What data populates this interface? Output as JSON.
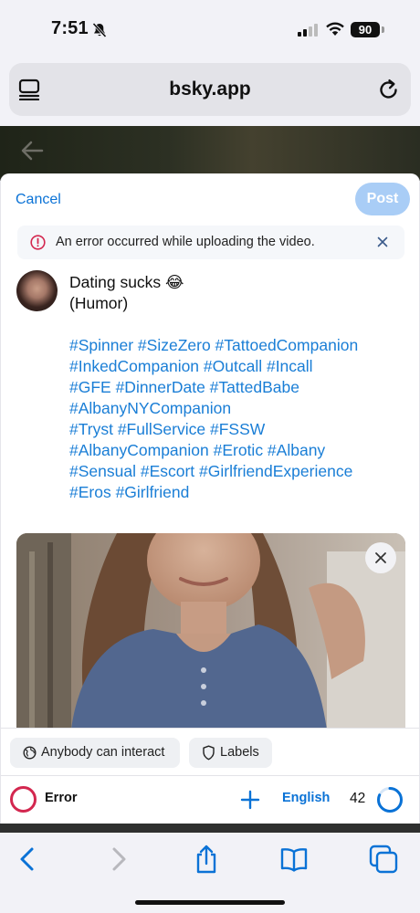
{
  "status_bar": {
    "time": "7:51",
    "battery": "90"
  },
  "browser": {
    "url": "bsky.app"
  },
  "composer": {
    "cancel_label": "Cancel",
    "post_label": "Post",
    "error_message": "An error occurred while uploading the video.",
    "post_text": {
      "line1": "Dating sucks 😂",
      "line2": "(Humor)",
      "hashtag_lines": [
        "#Spinner #SizeZero #TattoedCompanion",
        "#InkedCompanion #Outcall #Incall",
        "#GFE #DinnerDate #TattedBabe",
        "#AlbanyNYCompanion",
        "#Tryst #FullService #FSSW",
        "#AlbanyCompanion #Erotic #Albany",
        "#Sensual #Escort #GirlfriendExperience",
        "#Eros #Girlfriend"
      ]
    },
    "interaction_label": "Anybody can interact",
    "labels_label": "Labels",
    "status_label": "Error",
    "language_label": "English",
    "char_count": "42"
  },
  "colors": {
    "accent": "#0a72d6",
    "post_button_disabled": "#a9cdf6",
    "error": "#d3274f",
    "hashtag": "#1a7ed6"
  },
  "icons": {
    "tabs": "sidebar-tabs-icon",
    "reload": "reload-icon",
    "error": "info-circle-icon",
    "close": "close-icon",
    "remove_media": "close-icon",
    "interaction": "globe-icon",
    "labels": "shield-icon",
    "add": "plus-icon",
    "back": "chevron-left-icon",
    "forward": "chevron-right-icon",
    "share": "share-icon",
    "bookmarks": "book-icon",
    "tabs_overview": "tabs-icon"
  }
}
